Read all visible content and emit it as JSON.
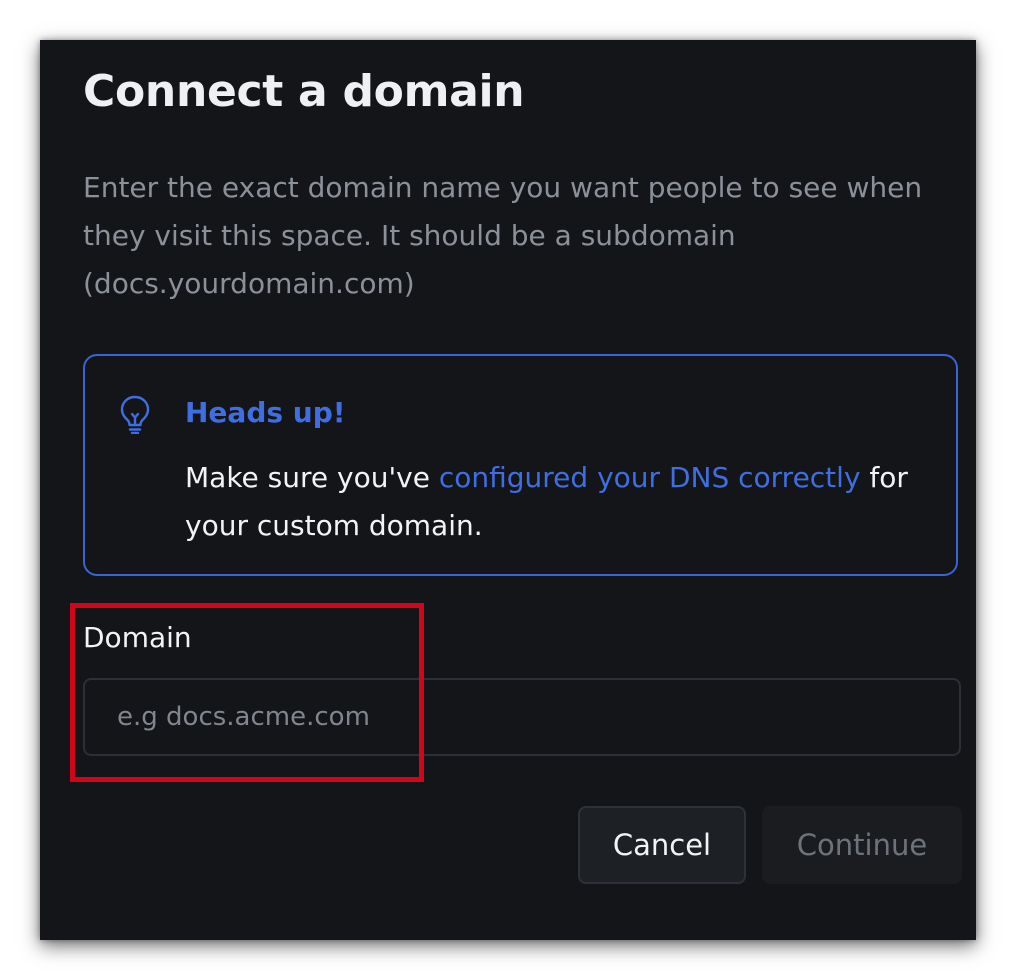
{
  "dialog": {
    "title": "Connect a domain",
    "description": "Enter the exact domain name you want people to see when they visit this space. It should be a subdomain (docs.yourdomain.com)"
  },
  "callout": {
    "icon": "lightbulb-icon",
    "title": "Heads up!",
    "body_before": "Make sure you've ",
    "link_text": "configured your DNS correctly",
    "body_after": " for your custom domain.",
    "accent_color": "#3f6ee0"
  },
  "domain_field": {
    "label": "Domain",
    "value": "",
    "placeholder": "e.g docs.acme.com"
  },
  "buttons": {
    "cancel_label": "Cancel",
    "continue_label": "Continue"
  },
  "annotation": {
    "highlight_color": "#d0061a"
  }
}
